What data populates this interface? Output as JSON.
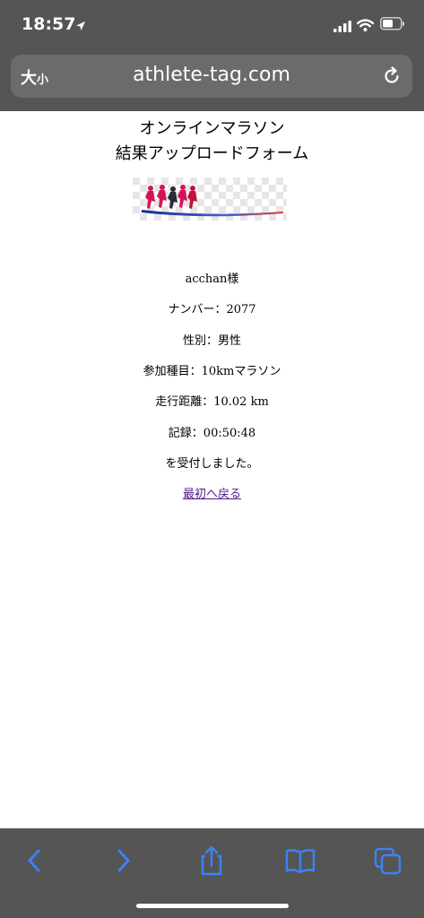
{
  "status_bar": {
    "time": "18:57"
  },
  "url_bar": {
    "text_size_large": "大",
    "text_size_small": "小",
    "url": "athlete-tag.com"
  },
  "page": {
    "title_line1": "オンラインマラソン",
    "title_line2": "結果アップロードフォーム",
    "user_name": "acchan様",
    "number": "ナンバー：2077",
    "gender": "性別：男性",
    "event": "参加種目：10kmマラソン",
    "distance": "走行距離：10.02 km",
    "record": "記録：00:50:48",
    "received": "を受付しました。",
    "back_link": "最初へ戻る"
  },
  "toolbar": {
    "icons": [
      "back-icon",
      "forward-icon",
      "share-icon",
      "bookmarks-icon",
      "tabs-icon"
    ]
  },
  "colors": {
    "chrome": "#555555",
    "url_field": "#6b6b6b",
    "toolbar_icon": "#3b82f6",
    "link_visited": "#551a8b"
  }
}
